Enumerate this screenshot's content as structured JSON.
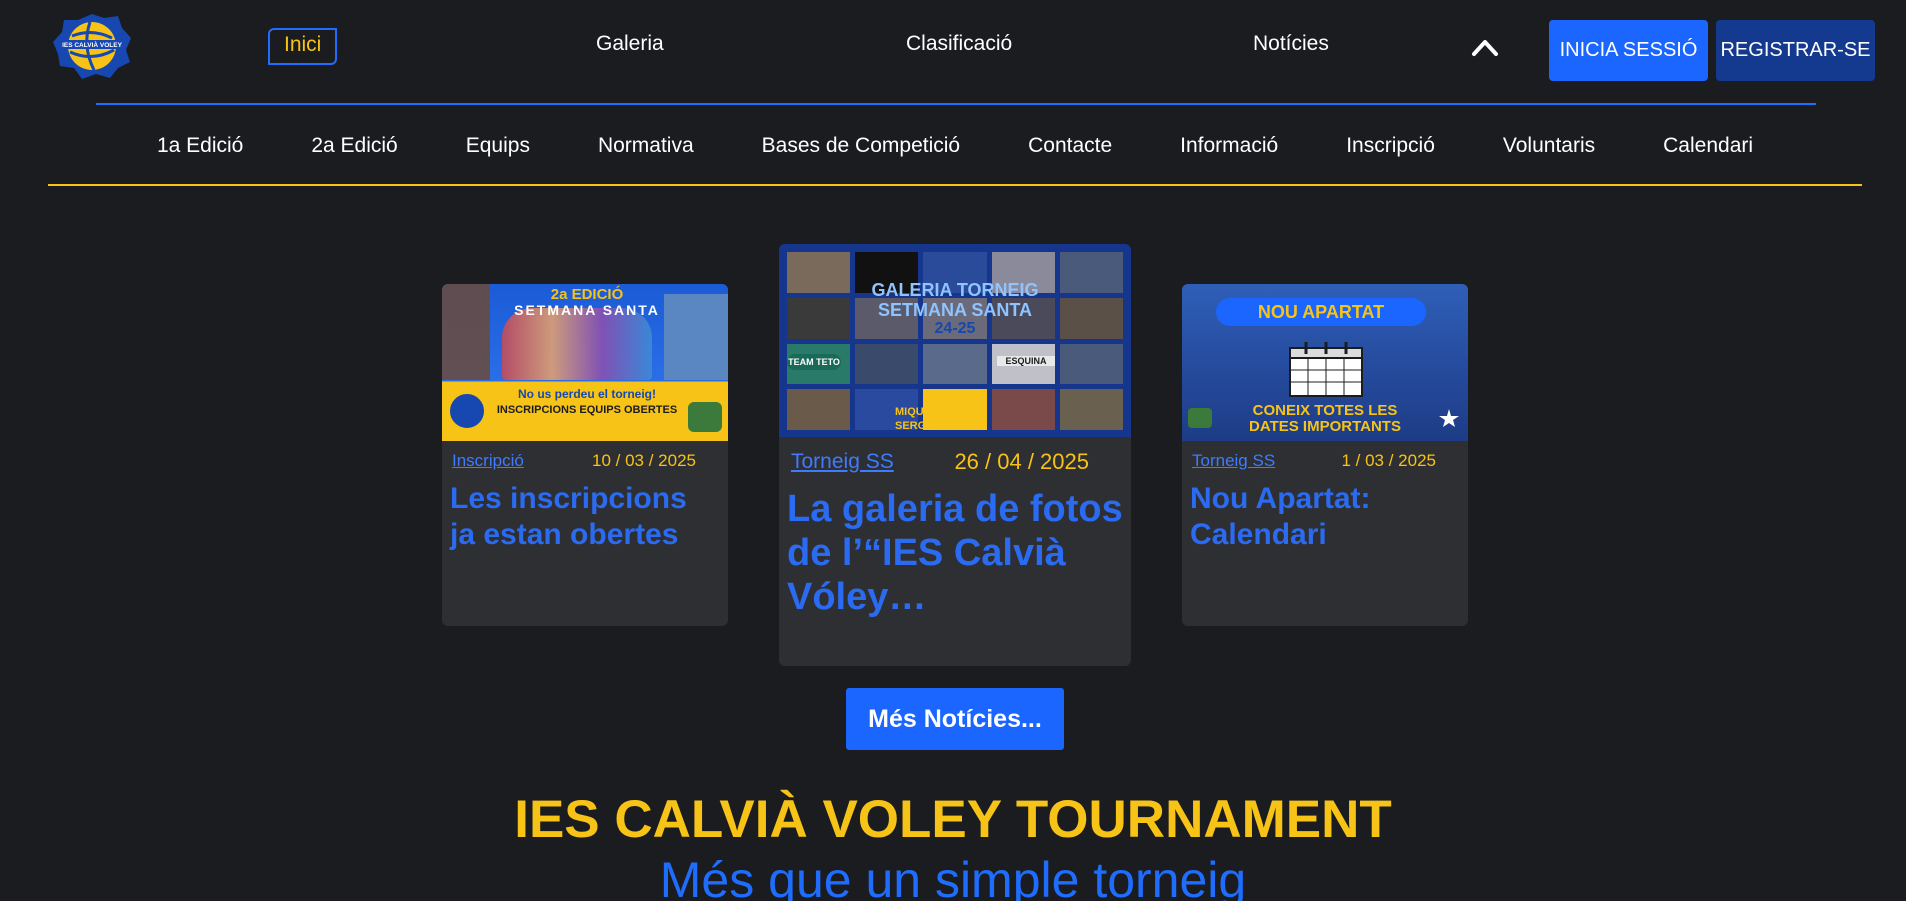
{
  "header": {
    "logo_text": "IES CALVIÀ VOLEY",
    "nav": [
      "Inici",
      "Galeria",
      "Clasificació",
      "Notícies"
    ],
    "login_label": "INICIA SESSIÓ",
    "register_label": "REGISTRAR-SE"
  },
  "subnav": [
    "1a Edició",
    "2a Edició",
    "Equips",
    "Normativa",
    "Bases de Competició",
    "Contacte",
    "Informació",
    "Inscripció",
    "Voluntaris",
    "Calendari"
  ],
  "cards": [
    {
      "category": "Inscripció",
      "date": "10 / 03 / 2025",
      "title": "Les inscripcions ja estan obertes",
      "poster": {
        "line1": "2a EDICIÓ",
        "line2": "SETMANA SANTA",
        "line3": "No us perdeu el torneig!",
        "line4": "INSCRIPCIONS EQUIPS OBERTES"
      }
    },
    {
      "category": "Torneig SS",
      "date": "26 / 04 / 2025",
      "title": "La galeria de fotos de l’“IES Calvià Vóley…",
      "poster": {
        "line1": "GALERIA TORNEIG",
        "line2": "SETMANA SANTA",
        "line3": "24-25",
        "line4": "MIQUEL",
        "line5": "SERGIO",
        "badge1": "TEAM TETO",
        "badge2": "ESQUINA"
      }
    },
    {
      "category": "Torneig SS",
      "date": "1 / 03 / 2025",
      "title": "Nou Apartat: Calendari",
      "poster": {
        "line1": "NOU APARTAT",
        "line2": "CONEIX TOTES LES",
        "line3": "DATES IMPORTANTS"
      }
    }
  ],
  "more_news_label": "Més Notícies...",
  "headline": "IES CALVIÀ VOLEY TOURNAMENT",
  "subheadline": "Més que un simple torneig",
  "colors": {
    "background": "#1b1c20",
    "accent_blue": "#1a66ff",
    "accent_yellow": "#f7c316",
    "card_bg": "#2e2f33"
  }
}
